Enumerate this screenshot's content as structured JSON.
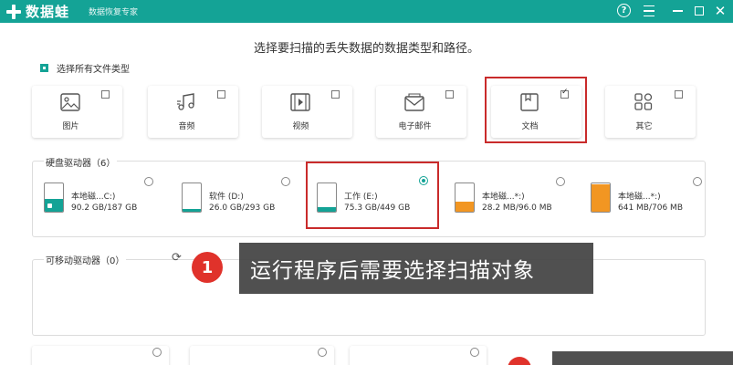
{
  "app": {
    "name": "数据蛙",
    "subtitle": "数据恢复专家",
    "help_glyph": "?",
    "close_glyph": "✕",
    "accent_color": "#14a396",
    "highlight_color": "#c92b2b"
  },
  "heading": "选择要扫描的丢失数据的数据类型和路径。",
  "select_all": {
    "label": "选择所有文件类型",
    "checked": true
  },
  "file_types": [
    {
      "label": "图片",
      "icon": "image-icon",
      "checked": false
    },
    {
      "label": "音频",
      "icon": "music-icon",
      "checked": false
    },
    {
      "label": "视频",
      "icon": "video-icon",
      "checked": false
    },
    {
      "label": "电子邮件",
      "icon": "email-icon",
      "checked": false
    },
    {
      "label": "文档",
      "icon": "document-icon",
      "checked": true
    },
    {
      "label": "其它",
      "icon": "other-icon",
      "checked": false
    }
  ],
  "hard_drives": {
    "title": "硬盘驱动器（6）",
    "items": [
      {
        "name": "本地磁...C:)",
        "size": "90.2 GB/187 GB",
        "selected": false
      },
      {
        "name": "软件 (D:)",
        "size": "26.0 GB/293 GB",
        "selected": false
      },
      {
        "name": "工作 (E:)",
        "size": "75.3 GB/449 GB",
        "selected": true
      },
      {
        "name": "本地磁...*:)",
        "size": "28.2 MB/96.0 MB",
        "selected": false
      },
      {
        "name": "本地磁...*:)",
        "size": "641 MB/706 MB",
        "selected": false
      }
    ]
  },
  "removable": {
    "title": "可移动驱动器（0）"
  },
  "callout": {
    "number": "1",
    "text": "运行程序后需要选择扫描对象"
  }
}
